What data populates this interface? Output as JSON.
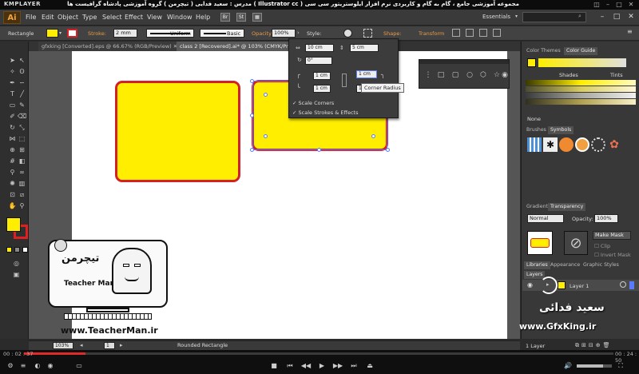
{
  "player": {
    "name": "KMPLAYER",
    "title": "مجموعه آموزشی جامع ، گام به گام و کاربردی نرم افزار ایلوستریتور سی سی ( Illustrator cc )   مدرس : سعید فدایی ( تیچرمن ) گروه آموزشی پادشاه گرافیست ها",
    "time_elapsed": "00 : 02 : 37",
    "time_total": "00 : 24 : 50",
    "progress": 0.105
  },
  "app": {
    "logo": "Ai",
    "menus": [
      "File",
      "Edit",
      "Object",
      "Type",
      "Select",
      "Effect",
      "View",
      "Window",
      "Help"
    ],
    "workspace": "Essentials"
  },
  "control_bar": {
    "object_type": "Rectangle",
    "stroke_label": "Stroke:",
    "stroke_weight": "2 mm",
    "profile_uniform": "Uniform",
    "brush_basic": "Basic",
    "opacity_label": "Opacity:",
    "opacity_value": "100%",
    "style_label": "Style:",
    "shape_label": "Shape:",
    "transform_label": "Transform"
  },
  "tabs": [
    {
      "label": "gfxking [Converted].eps @ 66.67% (RGB/Preview)"
    },
    {
      "label": "class 2 [Recovered].ai* @ 103% (CMYK/Preview)"
    }
  ],
  "transform_popup": {
    "width": "10 cm",
    "height": "5 cm",
    "angle": "0°",
    "corner_tl": "1 cm",
    "corner_tr": "1 cm",
    "corner_bl": "1 cm",
    "corner_br": "1 cm",
    "scale_corners": "Scale Corners",
    "scale_strokes": "Scale Strokes & Effects",
    "tooltip": "Corner Radius"
  },
  "dock": {
    "color_tabs": [
      "Color Themes",
      "Color Guide"
    ],
    "shades_label": "Shades",
    "tints_label": "Tints",
    "none_label": "None",
    "brush_tabs": [
      "Brushes",
      "Symbols"
    ],
    "transparency_tabs": [
      "Gradient",
      "Transparency"
    ],
    "blend_mode": "Normal",
    "opacity_label": "Opacity:",
    "opacity_value": "100%",
    "make_mask": "Make Mask",
    "clip": "Clip",
    "invert_mask": "Invert Mask",
    "lib_tabs": [
      "Libraries",
      "Appearance",
      "Graphic Styles"
    ],
    "layers_tab": "Layers",
    "layer_name": "Layer 1",
    "layer_count": "1 Layer"
  },
  "status": {
    "zoom": "103%",
    "page": "1",
    "tool_name": "Rounded Rectangle"
  },
  "watermark": {
    "teacher_logo": "تیچرمن",
    "teacher_sub": "Teacher Man",
    "teacher_url": "www.TeacherMan.ir",
    "author_name": "سعید فدائی",
    "site_url": "www.GfxKing.ir"
  },
  "colors": {
    "fill": "#ffee00",
    "stroke": "#d42028",
    "accent": "#e89b4a",
    "progress": "#e02a2a"
  }
}
